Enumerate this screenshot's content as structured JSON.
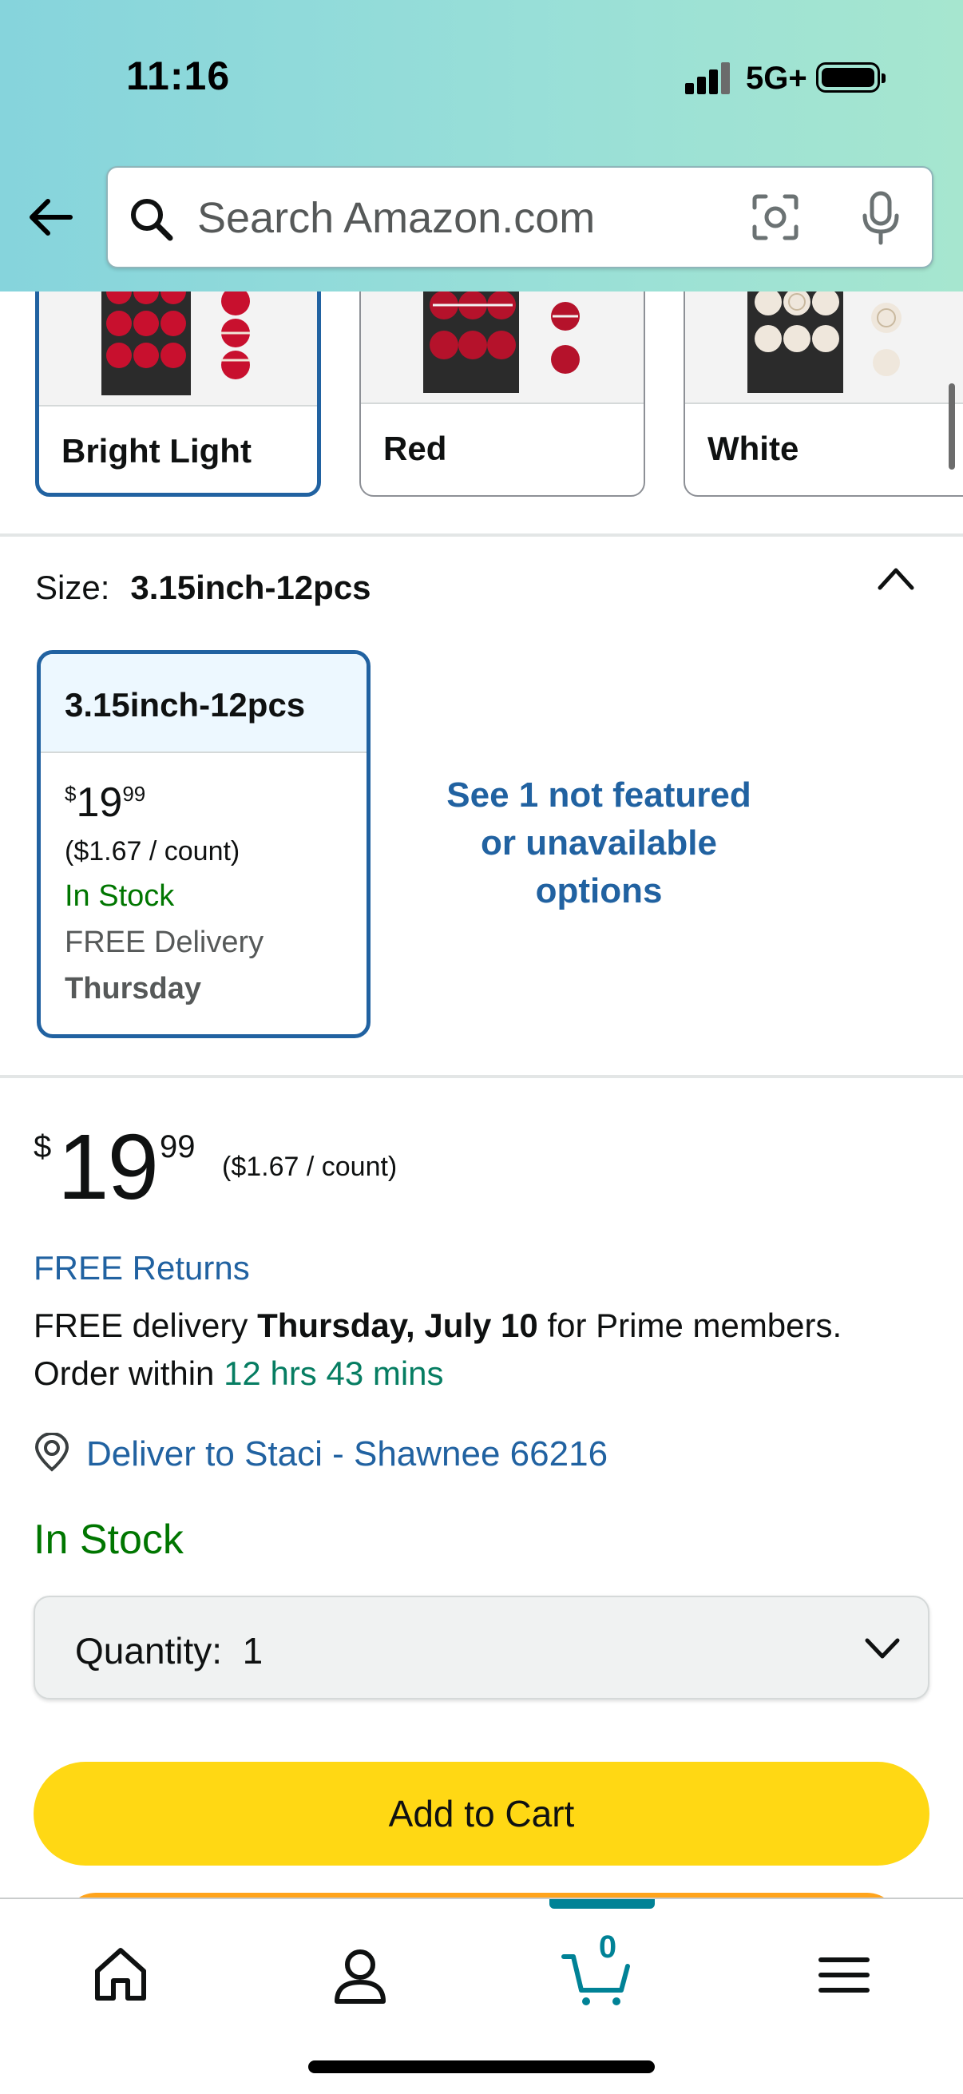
{
  "status_bar": {
    "time": "11:16",
    "network": "5G+"
  },
  "header": {
    "search_placeholder": "Search Amazon.com"
  },
  "colors": {
    "header_gradient_start": "#86d4dc",
    "header_gradient_end": "#a6e6cf",
    "link_blue": "#2162a1",
    "stock_green": "#007600",
    "time_green": "#067d62",
    "cart_button": "#ffd814",
    "buy_now": "#ffa41c",
    "nav_accent": "#008296"
  },
  "color_swatches": [
    {
      "label": "Bright Light",
      "selected": true
    },
    {
      "label": "Red",
      "selected": false
    },
    {
      "label": "White",
      "selected": false
    }
  ],
  "size": {
    "label": "Size:",
    "value": "3.15inch-12pcs",
    "option": {
      "title": "3.15inch-12pcs",
      "price_symbol": "$",
      "price_whole": "19",
      "price_fraction": "99",
      "unit_price": "($1.67 / count)",
      "stock": "In Stock",
      "delivery": "FREE Delivery",
      "delivery_day": "Thursday"
    },
    "see_more_line1": "See 1 not featured",
    "see_more_line2": "or unavailable",
    "see_more_line3": "options"
  },
  "buy_box": {
    "price_symbol": "$",
    "price_whole": "19",
    "price_fraction": "99",
    "unit_price": "($1.67 / count)",
    "free_returns": "FREE Returns",
    "delivery_prefix": "FREE delivery",
    "delivery_date": "Thursday, July 10",
    "delivery_suffix": "for Prime members.",
    "order_within_prefix": "Order within",
    "order_within_time": "12 hrs 43 mins",
    "deliver_to": "Deliver to Staci - Shawnee 66216",
    "stock": "In Stock",
    "quantity_label": "Quantity:",
    "quantity_value": "1",
    "add_to_cart": "Add to Cart"
  },
  "bottom_nav": {
    "cart_count": "0",
    "items": [
      "home-icon",
      "account-icon",
      "cart-icon",
      "menu-icon"
    ]
  }
}
